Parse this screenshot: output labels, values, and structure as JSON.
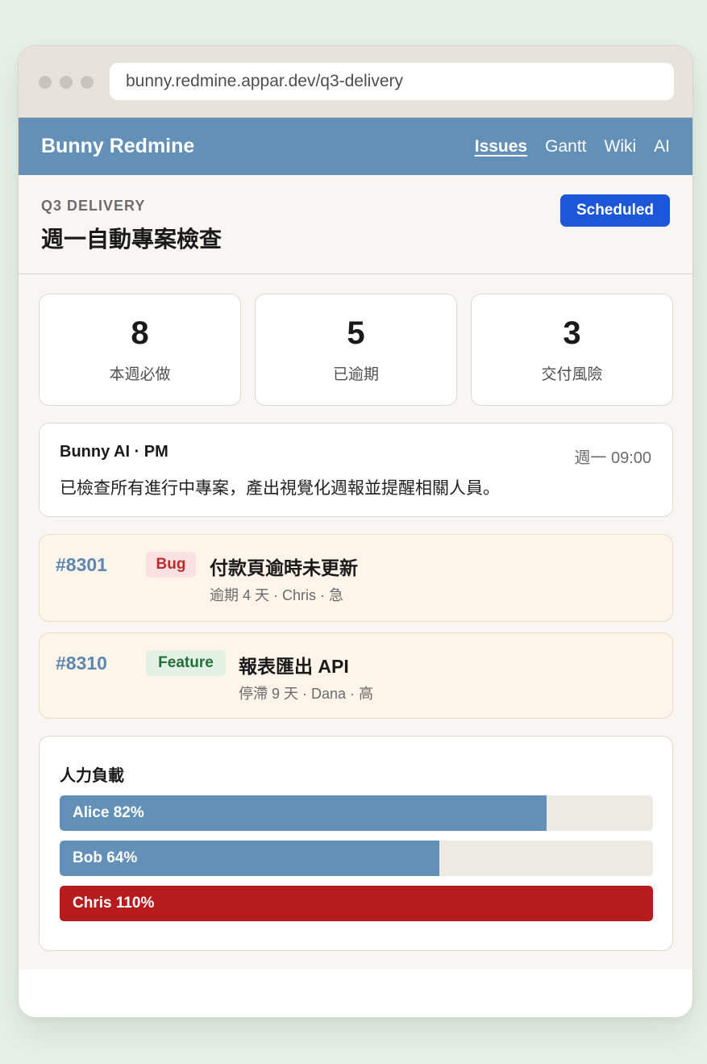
{
  "browser": {
    "url": "bunny.redmine.appar.dev/q3-delivery"
  },
  "navbar": {
    "brand": "Bunny Redmine",
    "links": [
      {
        "label": "Issues",
        "active": true
      },
      {
        "label": "Gantt",
        "active": false
      },
      {
        "label": "Wiki",
        "active": false
      },
      {
        "label": "AI",
        "active": false
      }
    ]
  },
  "project": {
    "eyebrow": "Q3 DELIVERY",
    "title": "週一自動專案檢查",
    "status": "Scheduled"
  },
  "stats": [
    {
      "value": "8",
      "label": "本週必做"
    },
    {
      "value": "5",
      "label": "已逾期"
    },
    {
      "value": "3",
      "label": "交付風險"
    }
  ],
  "ai_message": {
    "sender": "Bunny AI · PM",
    "time": "週一 09:00",
    "text": "已檢查所有進行中專案，產出視覺化週報並提醒相關人員。"
  },
  "issues": [
    {
      "id": "#8301",
      "tag": "Bug",
      "title": "付款頁逾時未更新",
      "meta": "逾期 4 天 · Chris · 急"
    },
    {
      "id": "#8310",
      "tag": "Feature",
      "title": "報表匯出 API",
      "meta": "停滯 9 天 · Dana · 高"
    }
  ],
  "workload": {
    "title": "人力負載",
    "people": [
      {
        "label": "Alice 82%",
        "percent": 82
      },
      {
        "label": "Bob 64%",
        "percent": 64
      },
      {
        "label": "Chris 110%",
        "percent": 110
      }
    ]
  },
  "colors": {
    "accent": "#6290b7",
    "status_badge": "#1c57d9",
    "overload": "#b71c1c",
    "bug": "#bd2c2c",
    "feature": "#227038"
  }
}
